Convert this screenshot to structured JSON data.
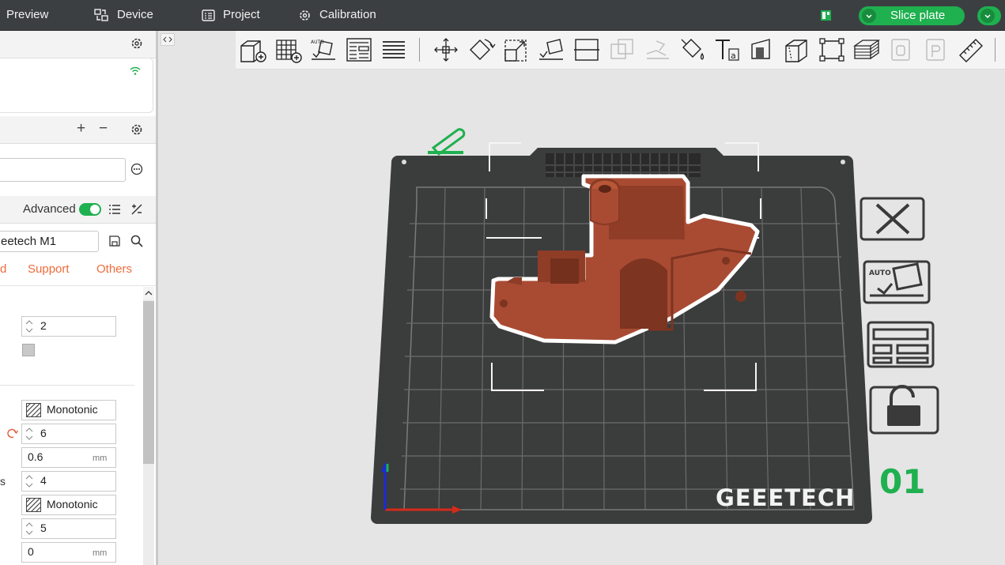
{
  "topbar": {
    "tabs": {
      "preview": "Preview",
      "device": "Device",
      "project": "Project",
      "calibration": "Calibration"
    },
    "slice_button": "Slice plate"
  },
  "sidebar": {
    "filament": {
      "add": "+",
      "remove": "−"
    },
    "process": {
      "advanced_label": "Advanced",
      "advanced_on": true,
      "preset_name": "eetech M1",
      "tabs": [
        {
          "label": "d"
        },
        {
          "label": "Support"
        },
        {
          "label": "Others"
        }
      ]
    },
    "settings": {
      "wall_loops": "2",
      "top_pattern": "Monotonic",
      "top_layers": "6",
      "top_thickness": "0.6",
      "top_unit": "mm",
      "bottom_layers_label": "s",
      "bottom_layers": "4",
      "bottom_pattern": "Monotonic",
      "bottom_shell_layers": "5",
      "bottom_thickness": "0",
      "bottom_unit": "mm"
    }
  },
  "plate": {
    "brand": "GEEETECH",
    "plate_number": "01"
  },
  "colors": {
    "accent": "#1fb04f",
    "topbar": "#3c3f42",
    "model": "#a94b33",
    "bed": "#3b3c3c",
    "tab_orange": "#f06c3c"
  }
}
